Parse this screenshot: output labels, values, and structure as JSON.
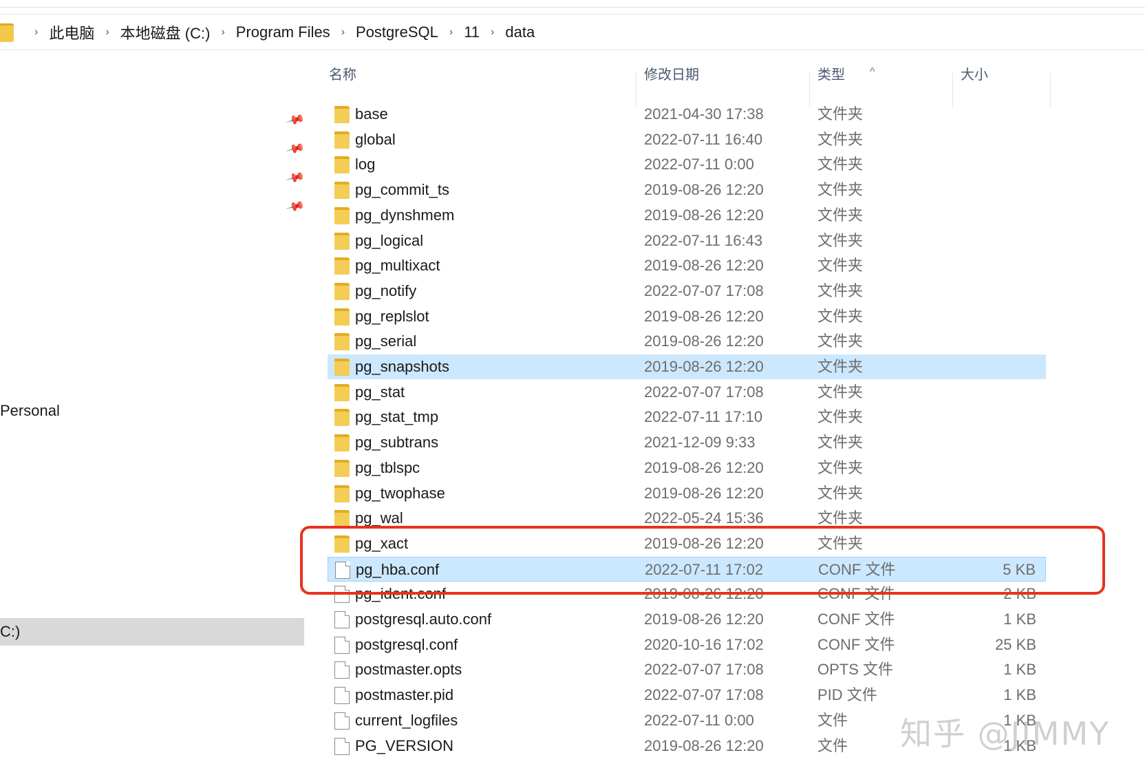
{
  "breadcrumb": {
    "items": [
      "此电脑",
      "本地磁盘 (C:)",
      "Program Files",
      "PostgreSQL",
      "11",
      "data"
    ],
    "separator": "›"
  },
  "sidebar": {
    "pin_icon": "📌",
    "personal_label": "Personal",
    "drive_label": "C:)"
  },
  "columns": {
    "name": "名称",
    "date": "修改日期",
    "type": "类型",
    "size": "大小"
  },
  "sort_indicator": "^",
  "rows": [
    {
      "icon": "folder",
      "name": "base",
      "date": "2021-04-30 17:38",
      "type": "文件夹",
      "size": ""
    },
    {
      "icon": "folder",
      "name": "global",
      "date": "2022-07-11 16:40",
      "type": "文件夹",
      "size": ""
    },
    {
      "icon": "folder",
      "name": "log",
      "date": "2022-07-11 0:00",
      "type": "文件夹",
      "size": ""
    },
    {
      "icon": "folder",
      "name": "pg_commit_ts",
      "date": "2019-08-26 12:20",
      "type": "文件夹",
      "size": ""
    },
    {
      "icon": "folder",
      "name": "pg_dynshmem",
      "date": "2019-08-26 12:20",
      "type": "文件夹",
      "size": ""
    },
    {
      "icon": "folder",
      "name": "pg_logical",
      "date": "2022-07-11 16:43",
      "type": "文件夹",
      "size": ""
    },
    {
      "icon": "folder",
      "name": "pg_multixact",
      "date": "2019-08-26 12:20",
      "type": "文件夹",
      "size": ""
    },
    {
      "icon": "folder",
      "name": "pg_notify",
      "date": "2022-07-07 17:08",
      "type": "文件夹",
      "size": ""
    },
    {
      "icon": "folder",
      "name": "pg_replslot",
      "date": "2019-08-26 12:20",
      "type": "文件夹",
      "size": ""
    },
    {
      "icon": "folder",
      "name": "pg_serial",
      "date": "2019-08-26 12:20",
      "type": "文件夹",
      "size": ""
    },
    {
      "icon": "folder",
      "name": "pg_snapshots",
      "date": "2019-08-26 12:20",
      "type": "文件夹",
      "size": ""
    },
    {
      "icon": "folder",
      "name": "pg_stat",
      "date": "2022-07-07 17:08",
      "type": "文件夹",
      "size": ""
    },
    {
      "icon": "folder",
      "name": "pg_stat_tmp",
      "date": "2022-07-11 17:10",
      "type": "文件夹",
      "size": ""
    },
    {
      "icon": "folder",
      "name": "pg_subtrans",
      "date": "2021-12-09 9:33",
      "type": "文件夹",
      "size": ""
    },
    {
      "icon": "folder",
      "name": "pg_tblspc",
      "date": "2019-08-26 12:20",
      "type": "文件夹",
      "size": ""
    },
    {
      "icon": "folder",
      "name": "pg_twophase",
      "date": "2019-08-26 12:20",
      "type": "文件夹",
      "size": ""
    },
    {
      "icon": "folder",
      "name": "pg_wal",
      "date": "2022-05-24 15:36",
      "type": "文件夹",
      "size": ""
    },
    {
      "icon": "folder",
      "name": "pg_xact",
      "date": "2019-08-26 12:20",
      "type": "文件夹",
      "size": ""
    },
    {
      "icon": "file",
      "name": "pg_hba.conf",
      "date": "2022-07-11 17:02",
      "type": "CONF 文件",
      "size": "5 KB"
    },
    {
      "icon": "file",
      "name": "pg_ident.conf",
      "date": "2019-08-26 12:20",
      "type": "CONF 文件",
      "size": "2 KB"
    },
    {
      "icon": "file",
      "name": "postgresql.auto.conf",
      "date": "2019-08-26 12:20",
      "type": "CONF 文件",
      "size": "1 KB"
    },
    {
      "icon": "file",
      "name": "postgresql.conf",
      "date": "2020-10-16 17:02",
      "type": "CONF 文件",
      "size": "25 KB"
    },
    {
      "icon": "file",
      "name": "postmaster.opts",
      "date": "2022-07-07 17:08",
      "type": "OPTS 文件",
      "size": "1 KB"
    },
    {
      "icon": "file",
      "name": "postmaster.pid",
      "date": "2022-07-07 17:08",
      "type": "PID 文件",
      "size": "1 KB"
    },
    {
      "icon": "file",
      "name": "current_logfiles",
      "date": "2022-07-11 0:00",
      "type": "文件",
      "size": "1 KB"
    },
    {
      "icon": "file",
      "name": "PG_VERSION",
      "date": "2019-08-26 12:20",
      "type": "文件",
      "size": "1 KB"
    }
  ],
  "watermark": "知乎 @JIMMY",
  "colors": {
    "selection": "#cce8ff",
    "highlight_box": "#e8321e",
    "folder": "#f3cd55"
  }
}
